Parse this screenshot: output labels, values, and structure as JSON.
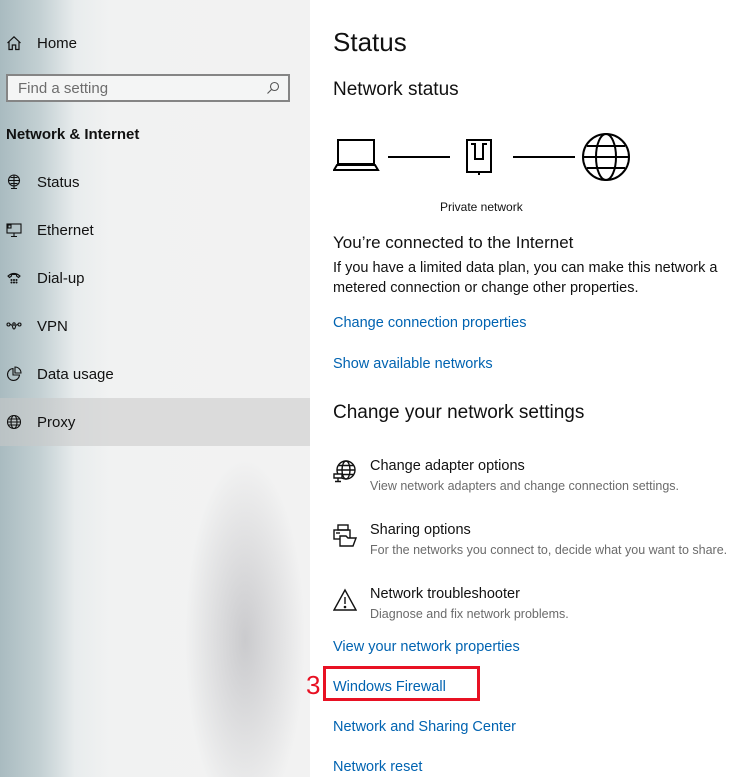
{
  "sidebar": {
    "home_label": "Home",
    "search": {
      "placeholder": "Find a setting",
      "value": ""
    },
    "section_title": "Network & Internet",
    "items": [
      {
        "label": "Status",
        "icon": "status-globe-monitor-icon",
        "active": false
      },
      {
        "label": "Ethernet",
        "icon": "ethernet-icon",
        "active": false
      },
      {
        "label": "Dial-up",
        "icon": "dial-up-phone-icon",
        "active": false
      },
      {
        "label": "VPN",
        "icon": "vpn-icon",
        "active": false
      },
      {
        "label": "Data usage",
        "icon": "data-usage-pie-icon",
        "active": false
      },
      {
        "label": "Proxy",
        "icon": "globe-icon",
        "active": true
      }
    ]
  },
  "main": {
    "title": "Status",
    "network_status_heading": "Network status",
    "diagram": {
      "nodes": [
        "laptop-icon",
        "router-icon",
        "globe-icon"
      ],
      "network_label": "Private network"
    },
    "connected_title": "You’re connected to the Internet",
    "connected_desc": "If you have a limited data plan, you can make this network a metered connection or change other properties.",
    "links_top": [
      "Change connection properties",
      "Show available networks"
    ],
    "change_settings_heading": "Change your network settings",
    "options": [
      {
        "title": "Change adapter options",
        "desc": "View network adapters and change connection settings.",
        "icon": "adapter-globe-icon"
      },
      {
        "title": "Sharing options",
        "desc": "For the networks you connect to, decide what you want to share.",
        "icon": "sharing-icon"
      },
      {
        "title": "Network troubleshooter",
        "desc": "Diagnose and fix network problems.",
        "icon": "warning-icon"
      }
    ],
    "links_bottom": [
      "View your network properties",
      "Windows Firewall",
      "Network and Sharing Center",
      "Network reset"
    ]
  },
  "annotation": {
    "number": "3",
    "color": "#e81123",
    "target": "Windows Firewall"
  },
  "colors": {
    "link": "#0063b1",
    "active_item_bg": "#d5d5d5"
  }
}
